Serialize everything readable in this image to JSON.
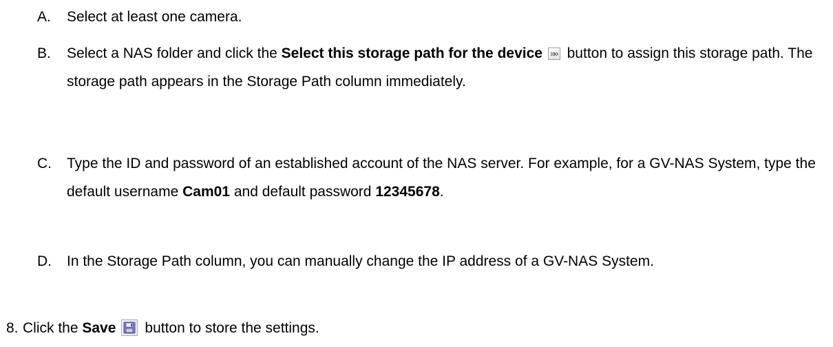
{
  "steps": [
    {
      "marker": "A.",
      "text": "Select at least one camera."
    },
    {
      "marker": "B.",
      "pre": "Select a NAS folder and click the ",
      "bold": "Select this storage path for the device",
      "icon": "double-arrow-button-icon",
      "post": " button to assign this storage path. The storage path appears in the Storage Path column immediately."
    },
    {
      "marker": "C.",
      "pre": "Type the ID and password of an established account of the NAS server. For example, for a GV-NAS System, type the default username ",
      "bold1": "Cam01",
      "mid": " and default password ",
      "bold2": "12345678",
      "post": "."
    },
    {
      "marker": "D.",
      "text": "In the Storage Path column, you can manually change the IP address of a GV-NAS System."
    },
    {
      "marker": "8.",
      "pre": "Click the ",
      "bold": "Save",
      "icon": "save-disk-icon",
      "post": "button to store the settings."
    }
  ]
}
